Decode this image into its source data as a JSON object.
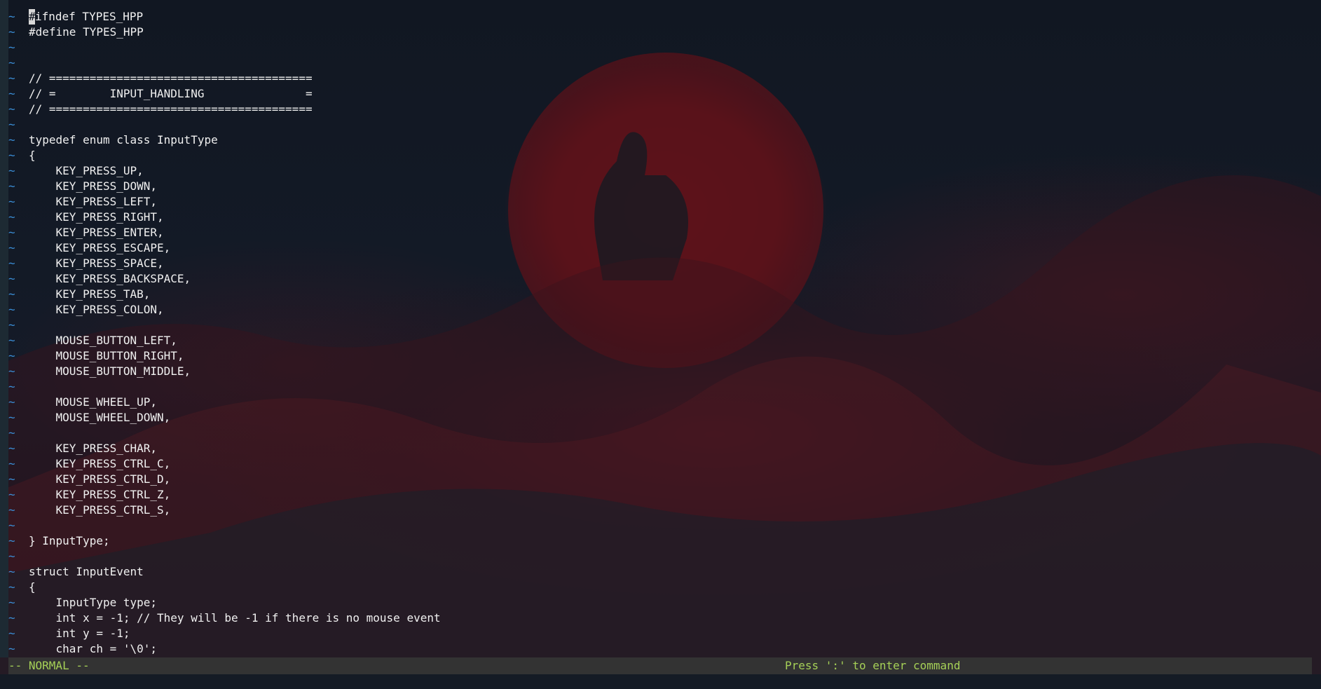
{
  "editor": {
    "lines": [
      "#ifndef TYPES_HPP",
      "#define TYPES_HPP",
      "",
      "",
      "// =======================================",
      "// =        INPUT_HANDLING               =",
      "// =======================================",
      "",
      "typedef enum class InputType",
      "{",
      "    KEY_PRESS_UP,",
      "    KEY_PRESS_DOWN,",
      "    KEY_PRESS_LEFT,",
      "    KEY_PRESS_RIGHT,",
      "    KEY_PRESS_ENTER,",
      "    KEY_PRESS_ESCAPE,",
      "    KEY_PRESS_SPACE,",
      "    KEY_PRESS_BACKSPACE,",
      "    KEY_PRESS_TAB,",
      "    KEY_PRESS_COLON,",
      "",
      "    MOUSE_BUTTON_LEFT,",
      "    MOUSE_BUTTON_RIGHT,",
      "    MOUSE_BUTTON_MIDDLE,",
      "",
      "    MOUSE_WHEEL_UP,",
      "    MOUSE_WHEEL_DOWN,",
      "",
      "    KEY_PRESS_CHAR,",
      "    KEY_PRESS_CTRL_C,",
      "    KEY_PRESS_CTRL_D,",
      "    KEY_PRESS_CTRL_Z,",
      "    KEY_PRESS_CTRL_S,",
      "",
      "} InputType;",
      "",
      "struct InputEvent",
      "{",
      "    InputType type;",
      "    int x = -1; // They will be -1 if there is no mouse event",
      "    int y = -1;",
      "    char ch = '\\0';"
    ],
    "gutter_symbol": "~"
  },
  "statusbar": {
    "mode": "-- NORMAL --",
    "hint": "Press ':' to enter command"
  },
  "colors": {
    "gutter": "#3b8fd8",
    "status_text": "#a6d157",
    "status_bg": "#333333",
    "background": "#0f1520"
  }
}
